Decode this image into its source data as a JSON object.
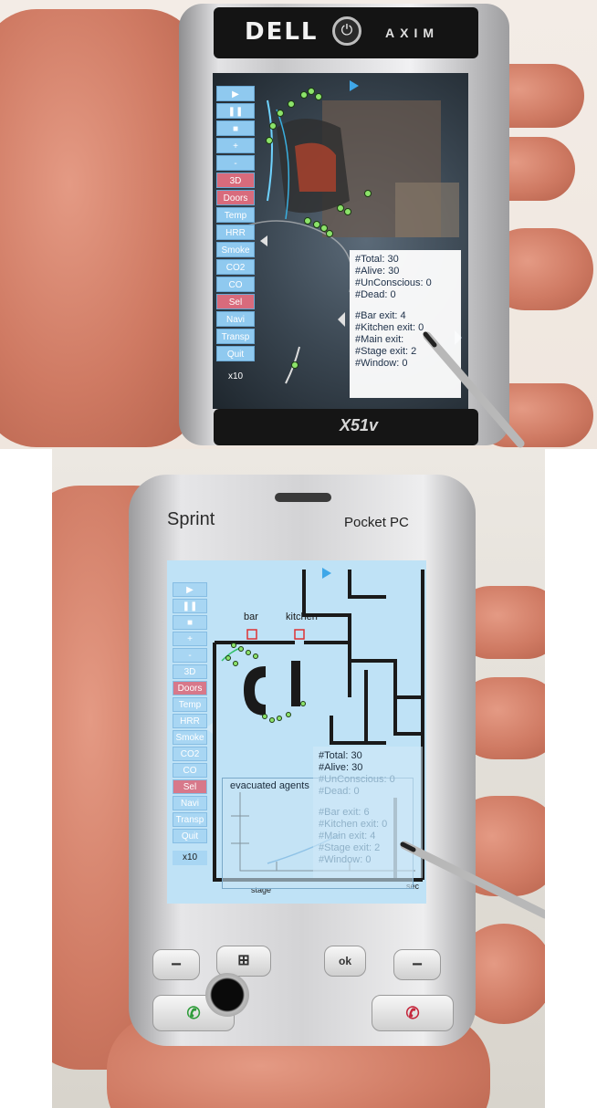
{
  "top_device": {
    "brand": "DELL",
    "model": "AXIM",
    "sub_model": "X51v",
    "toolbar": [
      "▶",
      "❚❚",
      "■",
      "+",
      "-",
      "3D",
      "Doors",
      "Temp",
      "HRR",
      "Smoke",
      "CO2",
      "CO",
      "Sel",
      "Navi",
      "Transp",
      "Quit",
      "x10"
    ],
    "active_buttons": [
      "3D",
      "Doors",
      "Sel"
    ],
    "stats": {
      "total": "#Total: 30",
      "alive": "#Alive: 30",
      "unconscious": "#UnConscious: 0",
      "dead": "#Dead: 0",
      "bar_exit": "#Bar exit: 4",
      "kitchen_exit": "#Kitchen exit: 0",
      "main_exit": "#Main exit:",
      "stage_exit": "#Stage exit: 2",
      "window": "#Window: 0"
    }
  },
  "bottom_device": {
    "brand": "Sprint",
    "model": "Pocket PC",
    "toolbar": [
      "▶",
      "❚❚",
      "■",
      "+",
      "-",
      "3D",
      "Doors",
      "Temp",
      "HRR",
      "Smoke",
      "CO2",
      "CO",
      "Sel",
      "Navi",
      "Transp",
      "Quit",
      "x10"
    ],
    "active_buttons": [
      "Doors",
      "Sel"
    ],
    "map_labels": {
      "bar": "bar",
      "kitchen": "kitchen",
      "stage": "stage",
      "sec": "sec"
    },
    "evac_title": "evacuated agents",
    "stats": {
      "total": "#Total: 30",
      "alive": "#Alive: 30",
      "unconscious": "#UnConscious: 0",
      "dead": "#Dead: 0",
      "bar_exit": "#Bar exit: 6",
      "kitchen_exit": "#Kitchen exit: 0",
      "main_exit": "#Main exit: 4",
      "stage_exit": "#Stage exit: 2",
      "window": "#Window: 0"
    },
    "keys": {
      "left_soft": "−",
      "windows": "⊞",
      "ok": "ok",
      "right_soft": "−"
    }
  },
  "colors": {
    "toolbar_button": "#8fc9ef",
    "toolbar_active": "#d86b7c",
    "agent": "#8ce36a",
    "skin": "#cf7a63"
  }
}
